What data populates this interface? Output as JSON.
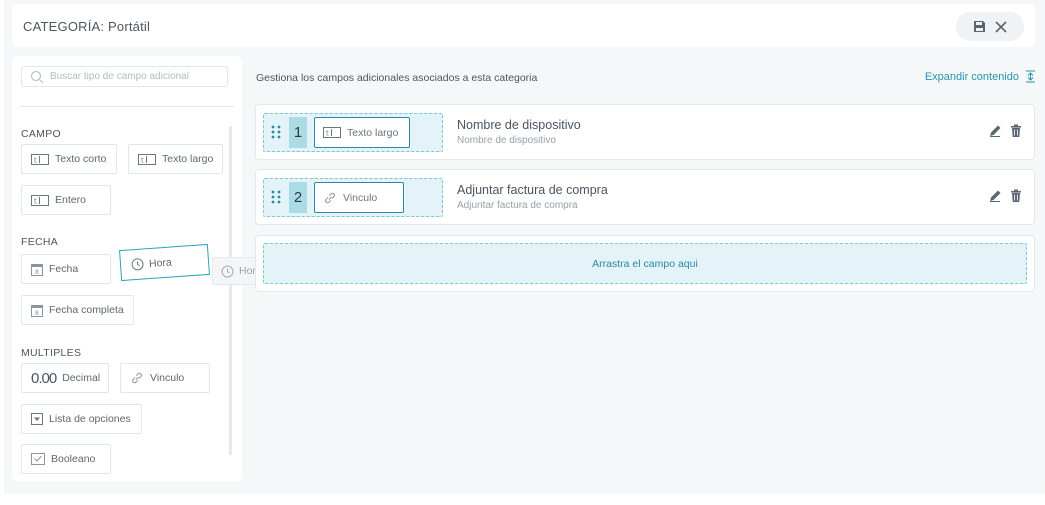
{
  "header": {
    "title": "CATEGORÍA: Portátil"
  },
  "sidebar": {
    "search_placeholder": "Buscar tipo de campo adicional",
    "sections": {
      "campo": "CAMPO",
      "fecha": "FECHA",
      "multiples": "MULTIPLES"
    },
    "items": {
      "texto_corto": "Texto corto",
      "texto_largo": "Texto largo",
      "entero": "Entero",
      "fecha": "Fecha",
      "fecha_completa": "Fecha completa",
      "decimal": "Decimal",
      "decimal_icon_text": "0.00",
      "vinculo": "Vinculo",
      "lista": "Lista de opciones",
      "booleano": "Booleano"
    },
    "dragging_label": "Hora",
    "ghost_label": "Hora"
  },
  "main": {
    "description": "Gestiona los campos adicionales asociados a esta categoria",
    "expand_label": "Expandir contenido",
    "fields": [
      {
        "order": "1",
        "type_label": "Texto largo",
        "name": "Nombre de dispositivo",
        "subtitle": "Nombre de dispositivo"
      },
      {
        "order": "2",
        "type_label": "Vinculo",
        "name": "Adjuntar factura de compra",
        "subtitle": "Adjuntar factura de compra"
      }
    ],
    "dropzone_label": "Arrastra el campo aqui"
  },
  "colors": {
    "accent": "#2596b0",
    "dropzone_bg": "#e3f3f7",
    "dropzone_border": "#7cc6d3"
  }
}
